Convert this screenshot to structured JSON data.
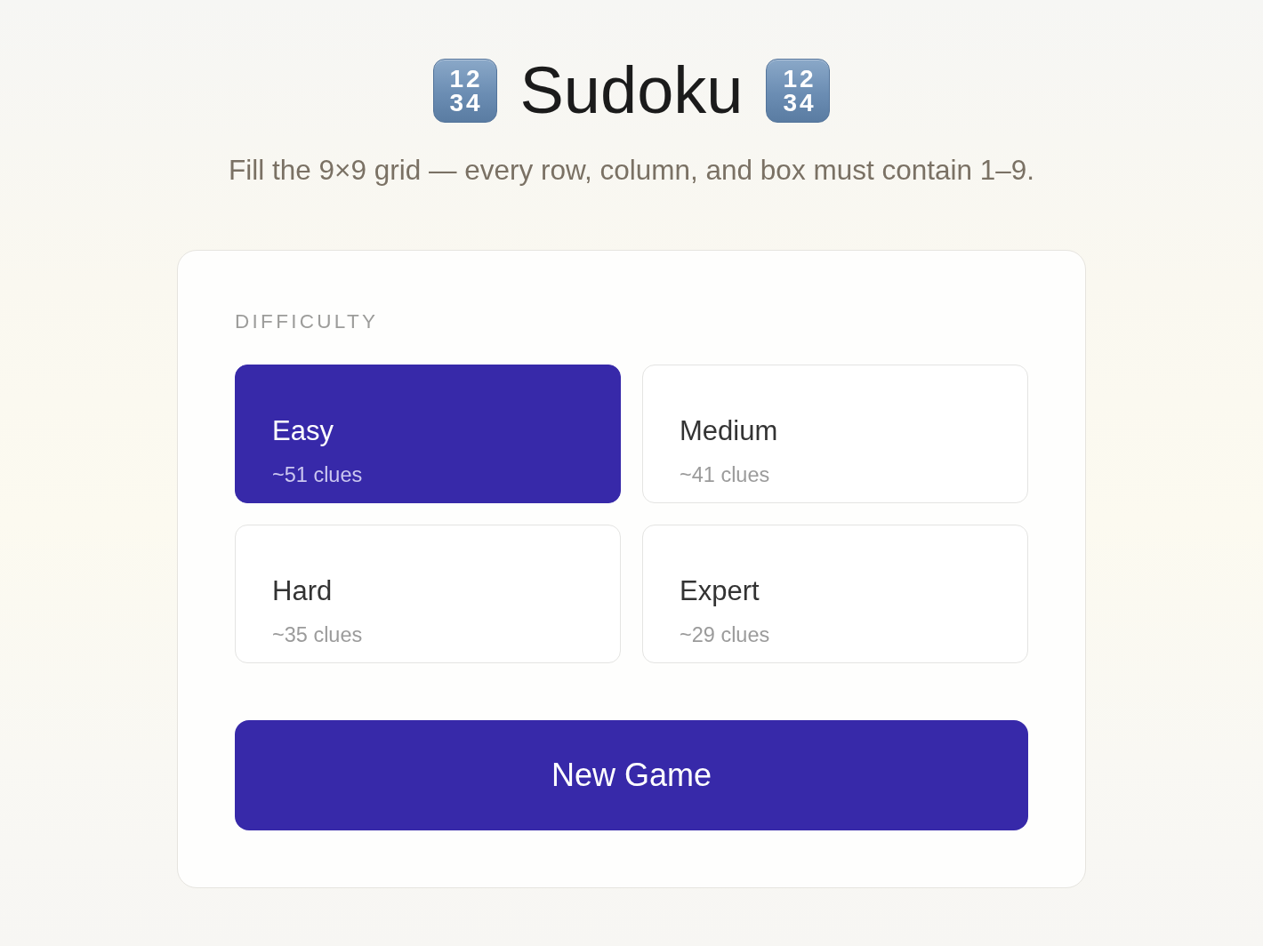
{
  "header": {
    "title": {
      "leading_badge": [
        "12",
        "34"
      ],
      "text": "Sudoku",
      "trailing_badge": [
        "12",
        "34"
      ]
    },
    "subtitle": "Fill the 9×9 grid — every row, column, and box must contain 1–9."
  },
  "difficulty": {
    "label": "DIFFICULTY",
    "options": [
      {
        "name": "Easy",
        "clues": "~51 clues",
        "selected": true
      },
      {
        "name": "Medium",
        "clues": "~41 clues",
        "selected": false
      },
      {
        "name": "Hard",
        "clues": "~35 clues",
        "selected": false
      },
      {
        "name": "Expert",
        "clues": "~29 clues",
        "selected": false
      }
    ],
    "new_game_button": "New Game"
  }
}
